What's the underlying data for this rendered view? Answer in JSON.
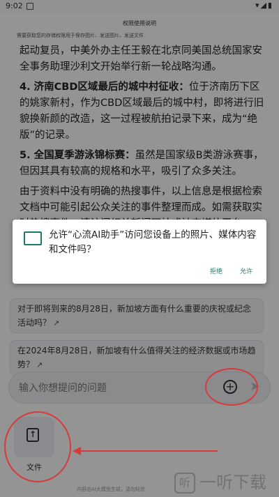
{
  "status": {
    "time": "9:02",
    "icons": "▾◢▮"
  },
  "banner": {
    "title": "权限使用说明",
    "subtitle": "需要获取您的存储权限用于保存图片、发送图片、发送文件"
  },
  "article": {
    "p0": "起动复员，中美外办主任王毅在北京同美国总统国家安全事务助理沙利文开始举行新一轮战略沟通。",
    "p1_head": "4. 济南CBD区域最后的城中村征收：",
    "p1_body": "位于济南历下区的姚家新村，作为CBD区域最后的城中村，即将进行旧貌换新颜的改造，这一过程被航拍记录下来，成为“绝版”的记录。",
    "p2_head": "5. 全国夏季游泳锦标赛：",
    "p2_body": "虽然是国家级B类游泳赛事，但因其具有较高的规格和水平，吸引了众多关注。",
    "p3": "由于资料中没有明确的热搜事件，以上信息是根据检索文档中可能引起公众关注的事件整理而成。如需获取实时热搜事件，请访问相关新闻网站或社交媒体平台。"
  },
  "suggestions": [
    {
      "text": "对于即将到来的8月28日，新加坡方面有什么重要的庆祝或纪念活动吗？",
      "icon": "external-link-icon"
    },
    {
      "text": "在2024年8月28日，新加坡有什么值得关注的经济数据或市场趋势？",
      "icon": "external-link-icon"
    }
  ],
  "input": {
    "placeholder": "输入你想提问的问题",
    "plus": "+",
    "send": "➤"
  },
  "file_tile": {
    "label": "文件",
    "icon": "↑"
  },
  "footer": "内容由AI大模型生成，请勿轻信",
  "watermark": {
    "logo": "听",
    "text": "一听下载"
  },
  "dialog": {
    "message": "允许“心流AI助手”访问您设备上的照片、媒体内容和文件吗？",
    "deny": "拒绝",
    "allow": "允许"
  },
  "colors": {
    "accent": "#1a7a6a",
    "annotation": "#d63a3a"
  }
}
